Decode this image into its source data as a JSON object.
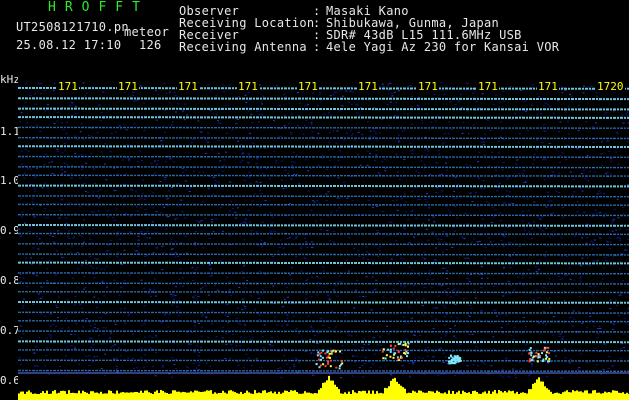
{
  "header": {
    "logo": "HROFFT",
    "filename": "UT2508121710.pn",
    "meteor_label": "meteor",
    "datetime": "25.08.12 17:10",
    "count": "126",
    "fields": [
      {
        "label": "Observer",
        "value": "Masaki Kano"
      },
      {
        "label": "Receiving Location",
        "value": "Shibukawa, Gunma, Japan"
      },
      {
        "label": "Receiver",
        "value": "SDR# 43dB L15 111.6MHz USB"
      },
      {
        "label": "Receiving Antenna",
        "value": "4ele Yagi Az 230 for Kansai VOR"
      }
    ],
    "separator": ":"
  },
  "yaxis": {
    "unit": "kHz",
    "ticks": [
      "1.1",
      "1.0",
      "0.9",
      "0.8",
      "0.7",
      "0.6"
    ]
  },
  "xaxis": {
    "ticks": [
      "171",
      "171",
      "171",
      "171",
      "171",
      "171",
      "171",
      "171",
      "171",
      "1720"
    ]
  },
  "colors": {
    "background": "#000000",
    "noise": "#0a1a8a",
    "trace": "#3fa0ff",
    "trace_bright": "#7fe8ff",
    "echo_hot": "#ff4040",
    "echo_warm": "#ffff40",
    "baseline": "#ffff00",
    "header_green": "#2ee82e",
    "header_white": "#e8e8e8"
  },
  "echoes": [
    {
      "minute_offset": 4.9,
      "freq_khz": 0.645,
      "strength": "strong"
    },
    {
      "minute_offset": 6.0,
      "freq_khz": 0.66,
      "strength": "strong"
    },
    {
      "minute_offset": 7.0,
      "freq_khz": 0.645,
      "strength": "weak"
    },
    {
      "minute_offset": 8.4,
      "freq_khz": 0.655,
      "strength": "medium"
    }
  ]
}
